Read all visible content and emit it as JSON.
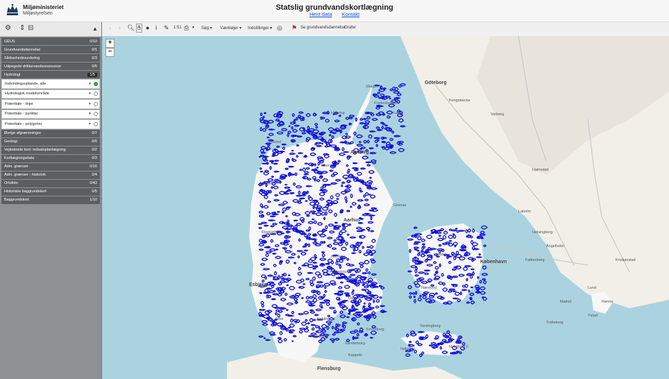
{
  "header": {
    "org_name": "Miljøministeriet",
    "org_sub": "Miljøstyrelsen",
    "title": "Statslig grundvandskortlægning",
    "links": [
      "Hent data",
      "Kontakt"
    ]
  },
  "sidebar": {
    "groups_top": [
      {
        "label": "GEUS",
        "count": "0/10"
      },
      {
        "label": "Grundvandsdannelse",
        "count": "0/1"
      },
      {
        "label": "Sårbarhedsvurdering",
        "count": "0/3"
      },
      {
        "label": "Udpegede drikkevandsressourcer",
        "count": "0/5"
      },
      {
        "label": "Hydrologi",
        "count": "1/5"
      }
    ],
    "layers": [
      {
        "label": "Indvindingsoplande, alle",
        "on": true
      },
      {
        "label": "Hydrologisk modelområde",
        "on": false
      },
      {
        "label": "Potentiale - linjer",
        "on": false
      },
      {
        "label": "Potentiale - punkter",
        "on": false
      },
      {
        "label": "Potentiale - polygoner",
        "on": false
      }
    ],
    "groups_bottom": [
      {
        "label": "Øvrige afgrænsninger",
        "count": "0/7"
      },
      {
        "label": "Geologi",
        "count": "0/9"
      },
      {
        "label": "Vejledende kort- indsatsplanlægning",
        "count": "0/2"
      },
      {
        "label": "Kortlægningsdata",
        "count": "0/3"
      },
      {
        "label": "Adm. grænser",
        "count": "0/16"
      },
      {
        "label": "Adm. grænser - historisk",
        "count": "0/4"
      },
      {
        "label": "Ortofoto",
        "count": "0/43"
      },
      {
        "label": "Historiske baggrundskort",
        "count": "0/5"
      },
      {
        "label": "Baggrundskort",
        "count": "1/10"
      }
    ]
  },
  "toolbar": {
    "search": "Søg",
    "tools": "Værktøjer",
    "settings": "Indstillinger",
    "gw_link": "Se grundvandsdannelse",
    "graphs": "Grafer",
    "measure": "1:51"
  },
  "map": {
    "cities": [
      "Göteborg",
      "København",
      "Aarhus",
      "Aalborg",
      "Horsens",
      "Fredericia",
      "Esbjerg",
      "Flensburg",
      "Kappeln",
      "Vordingborg",
      "Falkenberg",
      "Halmstad",
      "Helsingborg",
      "Malmö",
      "Trelleborg",
      "Ystad",
      "Viborg",
      "Grenaa",
      "Frederikshavn",
      "Holbæk",
      "Næstved",
      "Odense",
      "Kolding",
      "Skagen",
      "Hjørring",
      "Thisted",
      "Holstebro",
      "Ringkøbing",
      "Ribe",
      "Haderslev",
      "Sønderborg",
      "Svendborg",
      "Nakskov",
      "Nykøbing F",
      "Rønne",
      "Varberg",
      "Kungsbacka",
      "Lund",
      "Kristianstad",
      "Ängelholm",
      "Laholm",
      "Læsø"
    ]
  }
}
